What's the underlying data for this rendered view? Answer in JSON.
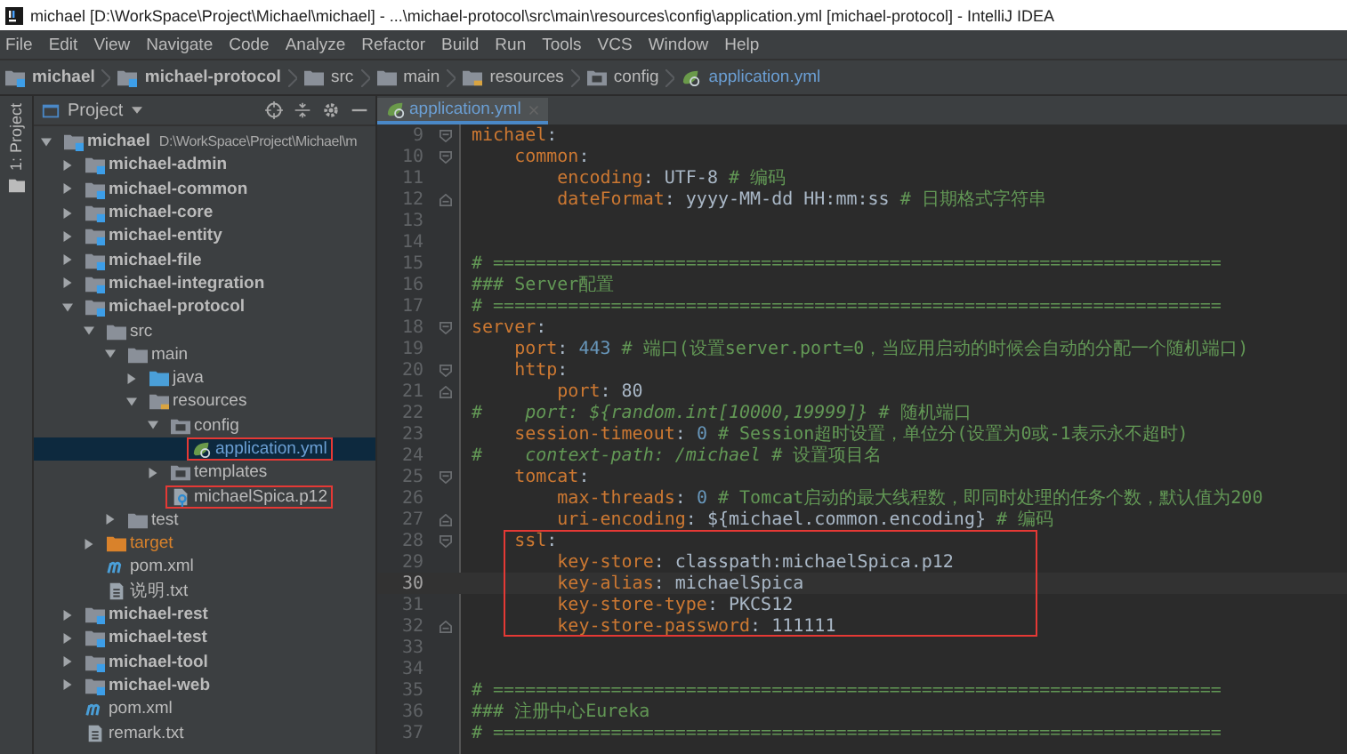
{
  "window": {
    "title": "michael [D:\\WorkSpace\\Project\\Michael\\michael] - ...\\michael-protocol\\src\\main\\resources\\config\\application.yml [michael-protocol] - IntelliJ IDEA"
  },
  "menu": [
    "File",
    "Edit",
    "View",
    "Navigate",
    "Code",
    "Analyze",
    "Refactor",
    "Build",
    "Run",
    "Tools",
    "VCS",
    "Window",
    "Help"
  ],
  "breadcrumbs": [
    {
      "label": "michael",
      "kind": "module"
    },
    {
      "label": "michael-protocol",
      "kind": "module"
    },
    {
      "label": "src",
      "kind": "folder"
    },
    {
      "label": "main",
      "kind": "folder"
    },
    {
      "label": "resources",
      "kind": "resources"
    },
    {
      "label": "config",
      "kind": "config"
    },
    {
      "label": "application.yml",
      "kind": "yml"
    }
  ],
  "project_panel": {
    "side_tab": "1: Project",
    "title": "Project",
    "tree": [
      {
        "name": "michael",
        "path": "D:\\WorkSpace\\Project\\Michael\\m",
        "kind": "module",
        "expanded": true,
        "selected": false,
        "highlighted": false,
        "children": [
          {
            "name": "michael-admin",
            "kind": "module",
            "expanded": false,
            "selected": false,
            "highlighted": false
          },
          {
            "name": "michael-common",
            "kind": "module",
            "expanded": false,
            "selected": false,
            "highlighted": false
          },
          {
            "name": "michael-core",
            "kind": "module",
            "expanded": false,
            "selected": false,
            "highlighted": false
          },
          {
            "name": "michael-entity",
            "kind": "module",
            "expanded": false,
            "selected": false,
            "highlighted": false
          },
          {
            "name": "michael-file",
            "kind": "module",
            "expanded": false,
            "selected": false,
            "highlighted": false
          },
          {
            "name": "michael-integration",
            "kind": "module",
            "expanded": false,
            "selected": false,
            "highlighted": false
          },
          {
            "name": "michael-protocol",
            "kind": "module",
            "expanded": true,
            "selected": false,
            "highlighted": false,
            "children": [
              {
                "name": "src",
                "kind": "folder",
                "expanded": true,
                "selected": false,
                "highlighted": false,
                "children": [
                  {
                    "name": "main",
                    "kind": "folder",
                    "expanded": true,
                    "selected": false,
                    "highlighted": false,
                    "children": [
                      {
                        "name": "java",
                        "kind": "source",
                        "expanded": false,
                        "selected": false,
                        "highlighted": false
                      },
                      {
                        "name": "resources",
                        "kind": "resources",
                        "expanded": true,
                        "selected": false,
                        "highlighted": false,
                        "children": [
                          {
                            "name": "config",
                            "kind": "config",
                            "expanded": true,
                            "selected": false,
                            "highlighted": false,
                            "children": [
                              {
                                "name": "application.yml",
                                "kind": "yml",
                                "selected": true,
                                "highlighted": true
                              }
                            ]
                          },
                          {
                            "name": "templates",
                            "kind": "config",
                            "expanded": false,
                            "selected": false,
                            "highlighted": false
                          },
                          {
                            "name": "michaelSpica.p12",
                            "kind": "cert",
                            "selected": false,
                            "highlighted": true
                          }
                        ]
                      }
                    ]
                  },
                  {
                    "name": "test",
                    "kind": "folder",
                    "expanded": false,
                    "selected": false,
                    "highlighted": false
                  }
                ]
              },
              {
                "name": "target",
                "kind": "excluded",
                "expanded": false,
                "selected": false,
                "highlighted": false
              },
              {
                "name": "pom.xml",
                "kind": "maven",
                "selected": false,
                "highlighted": false
              },
              {
                "name": "说明.txt",
                "kind": "text",
                "selected": false,
                "highlighted": false
              }
            ]
          },
          {
            "name": "michael-rest",
            "kind": "module",
            "expanded": false,
            "selected": false,
            "highlighted": false
          },
          {
            "name": "michael-test",
            "kind": "module",
            "expanded": false,
            "selected": false,
            "highlighted": false
          },
          {
            "name": "michael-tool",
            "kind": "module",
            "expanded": false,
            "selected": false,
            "highlighted": false
          },
          {
            "name": "michael-web",
            "kind": "module",
            "expanded": false,
            "selected": false,
            "highlighted": false
          },
          {
            "name": "pom.xml",
            "kind": "maven",
            "selected": false,
            "highlighted": false
          },
          {
            "name": "remark.txt",
            "kind": "text",
            "selected": false,
            "highlighted": false
          }
        ]
      }
    ]
  },
  "editor": {
    "tabs": [
      {
        "label": "application.yml",
        "selected": true
      }
    ],
    "lines": [
      {
        "number": "9",
        "fold_start": true,
        "fold_end": false,
        "current": false,
        "boxed": false,
        "tokens": [
          {
            "kind": "key",
            "text": "michael"
          },
          {
            "kind": "plain",
            "text": ":"
          }
        ]
      },
      {
        "number": "10",
        "fold_start": true,
        "fold_end": false,
        "current": false,
        "boxed": false,
        "tokens": [
          {
            "kind": "key",
            "text": "    common"
          },
          {
            "kind": "plain",
            "text": ":"
          }
        ]
      },
      {
        "number": "11",
        "fold_start": false,
        "fold_end": false,
        "current": false,
        "boxed": false,
        "tokens": [
          {
            "kind": "key",
            "text": "        encoding"
          },
          {
            "kind": "plain",
            "text": ": UTF-8 "
          },
          {
            "kind": "comment",
            "text": "# 编码"
          }
        ]
      },
      {
        "number": "12",
        "fold_start": false,
        "fold_end": true,
        "current": false,
        "boxed": false,
        "tokens": [
          {
            "kind": "key",
            "text": "        dateFormat"
          },
          {
            "kind": "plain",
            "text": ": yyyy-MM-dd HH:mm:ss "
          },
          {
            "kind": "comment",
            "text": "# 日期格式字符串"
          }
        ]
      },
      {
        "number": "13",
        "fold_start": false,
        "fold_end": false,
        "current": false,
        "boxed": false
      },
      {
        "number": "14",
        "fold_start": false,
        "fold_end": false,
        "current": false,
        "boxed": false
      },
      {
        "number": "15",
        "fold_start": false,
        "fold_end": false,
        "current": false,
        "boxed": false,
        "tokens": [
          {
            "kind": "comment",
            "text": "# ===================================================================="
          }
        ]
      },
      {
        "number": "16",
        "fold_start": false,
        "fold_end": false,
        "current": false,
        "boxed": false,
        "tokens": [
          {
            "kind": "comment",
            "text": "### Server配置"
          }
        ]
      },
      {
        "number": "17",
        "fold_start": false,
        "fold_end": false,
        "current": false,
        "boxed": false,
        "tokens": [
          {
            "kind": "comment",
            "text": "# ===================================================================="
          }
        ]
      },
      {
        "number": "18",
        "fold_start": true,
        "fold_end": false,
        "current": false,
        "boxed": false,
        "tokens": [
          {
            "kind": "key",
            "text": "server"
          },
          {
            "kind": "plain",
            "text": ":"
          }
        ]
      },
      {
        "number": "19",
        "fold_start": false,
        "fold_end": false,
        "current": false,
        "boxed": false,
        "tokens": [
          {
            "kind": "key",
            "text": "    port"
          },
          {
            "kind": "plain",
            "text": ": "
          },
          {
            "kind": "number",
            "text": "443"
          },
          {
            "kind": "comment",
            "text": " # 端口(设置server.port=0，当应用启动的时候会自动的分配一个随机端口)"
          }
        ]
      },
      {
        "number": "20",
        "fold_start": true,
        "fold_end": false,
        "current": false,
        "boxed": false,
        "tokens": [
          {
            "kind": "key",
            "text": "    http"
          },
          {
            "kind": "plain",
            "text": ":"
          }
        ]
      },
      {
        "number": "21",
        "fold_start": false,
        "fold_end": true,
        "current": false,
        "boxed": false,
        "tokens": [
          {
            "kind": "key",
            "text": "        port"
          },
          {
            "kind": "plain",
            "text": ": 80"
          }
        ]
      },
      {
        "number": "22",
        "fold_start": false,
        "fold_end": false,
        "current": false,
        "boxed": false,
        "tokens": [
          {
            "kind": "comment",
            "text": "#    *port: ${random.int[10000,19999]}* # 随机端口"
          }
        ]
      },
      {
        "number": "23",
        "fold_start": false,
        "fold_end": false,
        "current": false,
        "boxed": false,
        "tokens": [
          {
            "kind": "key",
            "text": "    session-timeout"
          },
          {
            "kind": "plain",
            "text": ": "
          },
          {
            "kind": "number",
            "text": "0"
          },
          {
            "kind": "comment",
            "text": " # Session超时设置，单位分(设置为0或-1表示永不超时)"
          }
        ]
      },
      {
        "number": "24",
        "fold_start": false,
        "fold_end": false,
        "current": false,
        "boxed": false,
        "tokens": [
          {
            "kind": "comment",
            "text": "#    *context-path: /michael* # 设置项目名"
          }
        ]
      },
      {
        "number": "25",
        "fold_start": true,
        "fold_end": false,
        "current": false,
        "boxed": false,
        "tokens": [
          {
            "kind": "key",
            "text": "    tomcat"
          },
          {
            "kind": "plain",
            "text": ":"
          }
        ]
      },
      {
        "number": "26",
        "fold_start": false,
        "fold_end": false,
        "current": false,
        "boxed": false,
        "tokens": [
          {
            "kind": "key",
            "text": "        max-threads"
          },
          {
            "kind": "plain",
            "text": ": "
          },
          {
            "kind": "number",
            "text": "0"
          },
          {
            "kind": "comment",
            "text": " # Tomcat启动的最大线程数，即同时处理的任务个数，默认值为200"
          }
        ]
      },
      {
        "number": "27",
        "fold_start": false,
        "fold_end": true,
        "current": false,
        "boxed": false,
        "tokens": [
          {
            "kind": "key",
            "text": "        uri-encoding"
          },
          {
            "kind": "plain",
            "text": ": ${michael.common.encoding} "
          },
          {
            "kind": "comment",
            "text": "# 编码"
          }
        ]
      },
      {
        "number": "28",
        "fold_start": true,
        "fold_end": false,
        "current": false,
        "boxed": true,
        "tokens": [
          {
            "kind": "key",
            "text": "    ssl"
          },
          {
            "kind": "plain",
            "text": ":"
          }
        ]
      },
      {
        "number": "29",
        "fold_start": false,
        "fold_end": false,
        "current": false,
        "boxed": true,
        "tokens": [
          {
            "kind": "key",
            "text": "        key-store"
          },
          {
            "kind": "plain",
            "text": ": classpath:michaelSpica.p12"
          }
        ]
      },
      {
        "number": "30",
        "fold_start": false,
        "fold_end": false,
        "current": true,
        "boxed": true,
        "tokens": [
          {
            "kind": "key",
            "text": "        key-alias"
          },
          {
            "kind": "plain",
            "text": ": michaelSpica"
          }
        ]
      },
      {
        "number": "31",
        "fold_start": false,
        "fold_end": false,
        "current": false,
        "boxed": true,
        "tokens": [
          {
            "kind": "key",
            "text": "        key-store-type"
          },
          {
            "kind": "plain",
            "text": ": PKCS12"
          }
        ]
      },
      {
        "number": "32",
        "fold_start": false,
        "fold_end": true,
        "current": false,
        "boxed": true,
        "tokens": [
          {
            "kind": "key",
            "text": "        key-store-password"
          },
          {
            "kind": "plain",
            "text": ": 111111"
          }
        ]
      },
      {
        "number": "33",
        "fold_start": false,
        "fold_end": false,
        "current": false,
        "boxed": false
      },
      {
        "number": "34",
        "fold_start": false,
        "fold_end": false,
        "current": false,
        "boxed": false
      },
      {
        "number": "35",
        "fold_start": false,
        "fold_end": false,
        "current": false,
        "boxed": false,
        "tokens": [
          {
            "kind": "comment",
            "text": "# ===================================================================="
          }
        ]
      },
      {
        "number": "36",
        "fold_start": false,
        "fold_end": false,
        "current": false,
        "boxed": false,
        "tokens": [
          {
            "kind": "comment",
            "text": "### 注册中心Eureka"
          }
        ]
      },
      {
        "number": "37",
        "fold_start": false,
        "fold_end": false,
        "current": false,
        "boxed": false,
        "tokens": [
          {
            "kind": "comment",
            "text": "# ===================================================================="
          }
        ]
      }
    ]
  }
}
